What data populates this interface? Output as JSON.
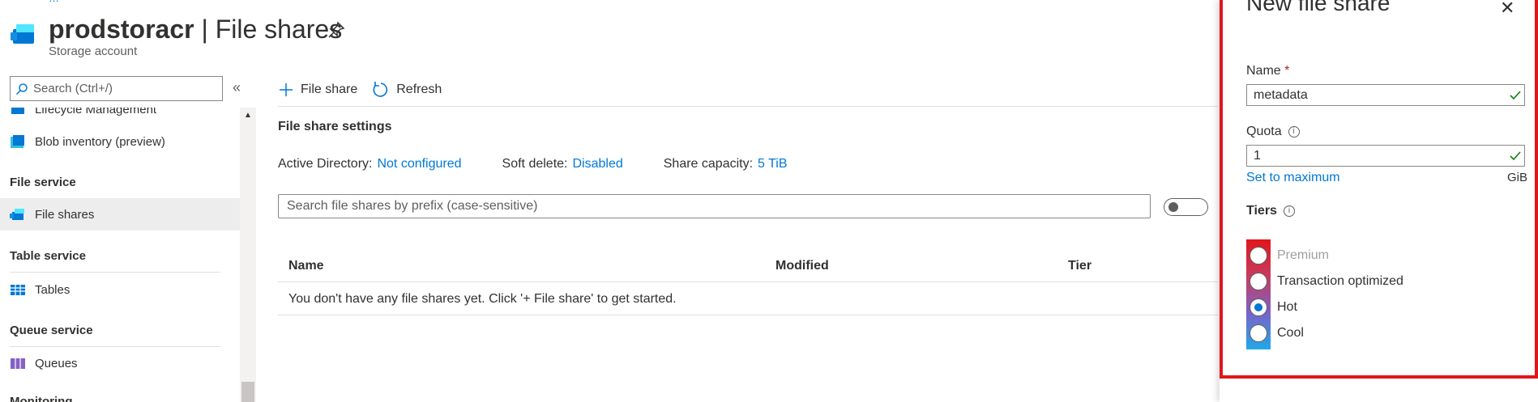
{
  "header": {
    "breadcrumb": "…",
    "resource_name": "prodstoracr",
    "separator": " | ",
    "page_name": "File shares",
    "subtitle": "Storage account"
  },
  "nav": {
    "search_placeholder": "Search (Ctrl+/)",
    "collapse_label": "«",
    "items": [
      {
        "label": "Lifecycle Management",
        "icon": "lifecycle-icon"
      },
      {
        "label": "Blob inventory (preview)",
        "icon": "inventory-icon"
      }
    ],
    "sections": [
      {
        "header": "File service",
        "items": [
          {
            "label": "File shares",
            "icon": "file-shares-icon",
            "selected": true
          }
        ]
      },
      {
        "header": "Table service",
        "items": [
          {
            "label": "Tables",
            "icon": "tables-icon"
          }
        ]
      },
      {
        "header": "Queue service",
        "items": [
          {
            "label": "Queues",
            "icon": "queues-icon"
          }
        ]
      },
      {
        "header": "Monitoring",
        "items": []
      }
    ]
  },
  "toolbar": {
    "add_label": "File share",
    "refresh_label": "Refresh"
  },
  "settings": {
    "title": "File share settings",
    "active_directory_key": "Active Directory:",
    "active_directory_value": "Not configured",
    "soft_delete_key": "Soft delete:",
    "soft_delete_value": "Disabled",
    "capacity_key": "Share capacity:",
    "capacity_value": "5 TiB"
  },
  "search": {
    "placeholder": "Search file shares by prefix (case-sensitive)"
  },
  "table": {
    "columns": [
      "Name",
      "Modified",
      "Tier"
    ],
    "empty_message": "You don't have any file shares yet. Click '+ File share' to get started."
  },
  "panel": {
    "title": "New file share",
    "name_label": "Name",
    "required_mark": "*",
    "name_value": "metadata",
    "quota_label": "Quota",
    "quota_value": "1",
    "set_max_label": "Set to maximum",
    "unit_label": "GiB",
    "tiers_label": "Tiers",
    "tiers": [
      {
        "label": "Premium",
        "disabled": true,
        "selected": false
      },
      {
        "label": "Transaction optimized",
        "disabled": false,
        "selected": false
      },
      {
        "label": "Hot",
        "disabled": false,
        "selected": true
      },
      {
        "label": "Cool",
        "disabled": false,
        "selected": false
      }
    ]
  },
  "colors": {
    "accent": "#0078d4",
    "highlight_border": "#e0161b",
    "valid_check": "#107c10"
  }
}
